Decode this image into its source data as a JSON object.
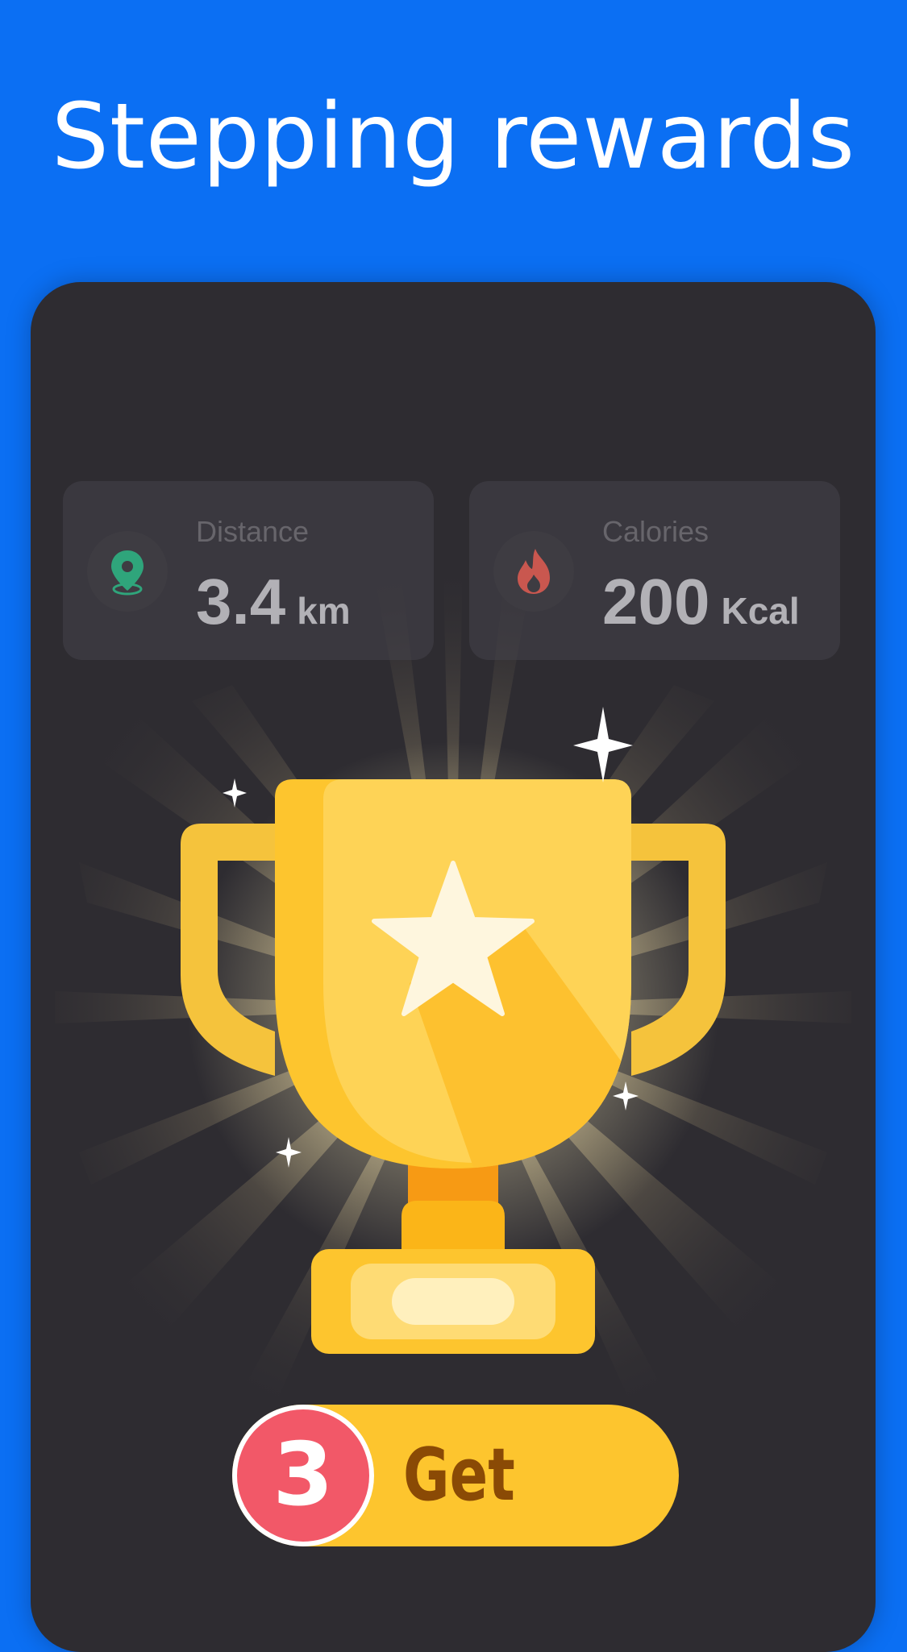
{
  "headline": "Stepping rewards",
  "stats": {
    "distance": {
      "label": "Distance",
      "value": "3.4",
      "unit": "km",
      "icon": "location-pin-icon",
      "icon_color": "#2fa57b"
    },
    "calories": {
      "label": "Calories",
      "value": "200",
      "unit": "Kcal",
      "icon": "flame-icon",
      "icon_color": "#c9574f"
    }
  },
  "reward_button": {
    "count": "3",
    "label": "Get"
  },
  "colors": {
    "background": "#0b6ff3",
    "panel": "#2e2c31",
    "trophy_gold": "#fdc52e",
    "badge": "#f25868",
    "button_text": "#8a4a05"
  }
}
